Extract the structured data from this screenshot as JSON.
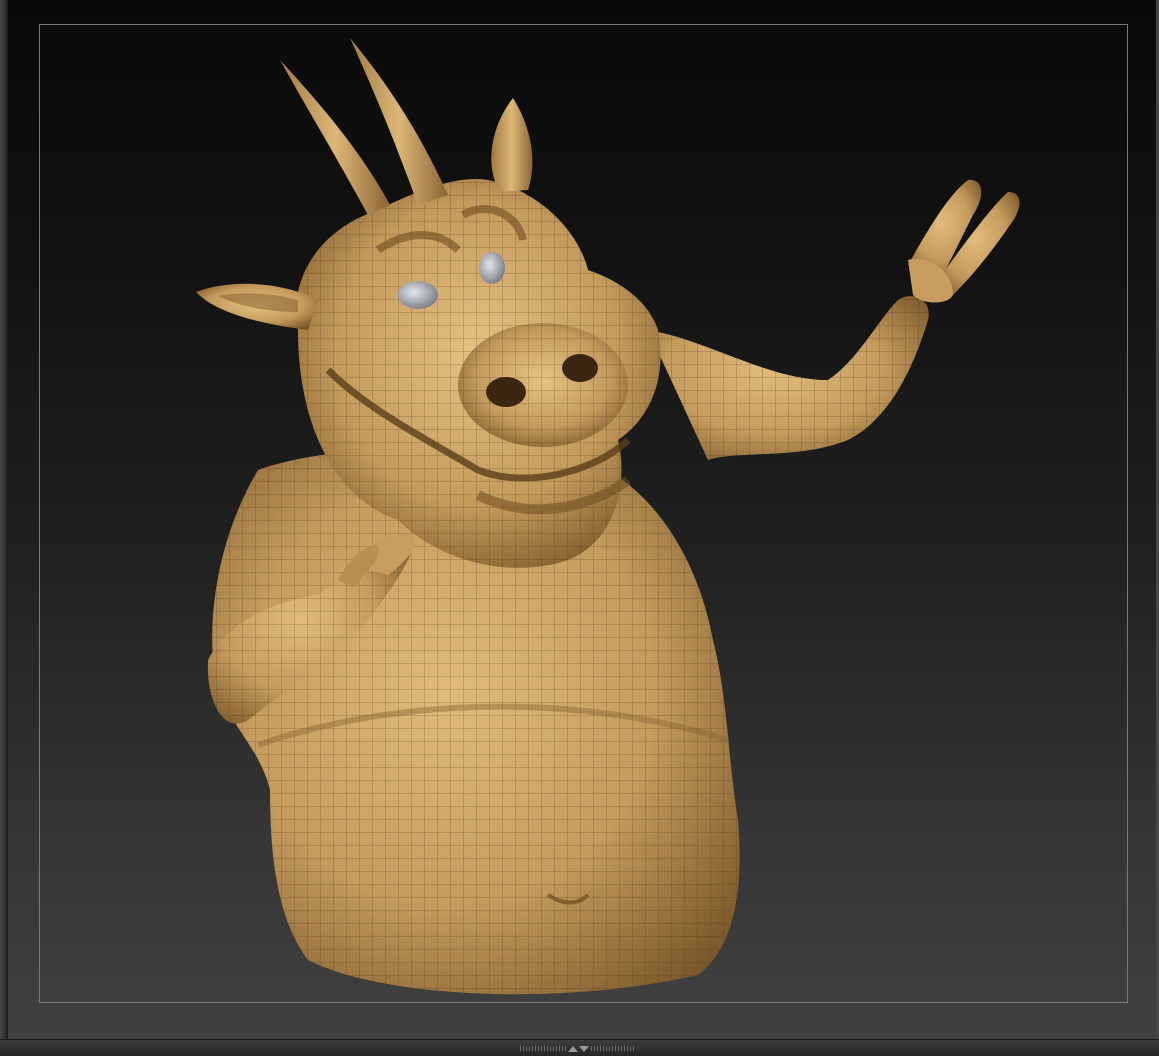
{
  "viewport": {
    "background_top": "#0a0a0a",
    "background_bottom": "#414141",
    "frame_color": "#7a7a7a",
    "model_color": "#c9a064",
    "model_shadow": "#6b4a22",
    "wire_color": "#4a3418",
    "eye_color": "#b8bcc4"
  },
  "icons": {
    "tray_handle": "double-arrow-icon"
  }
}
